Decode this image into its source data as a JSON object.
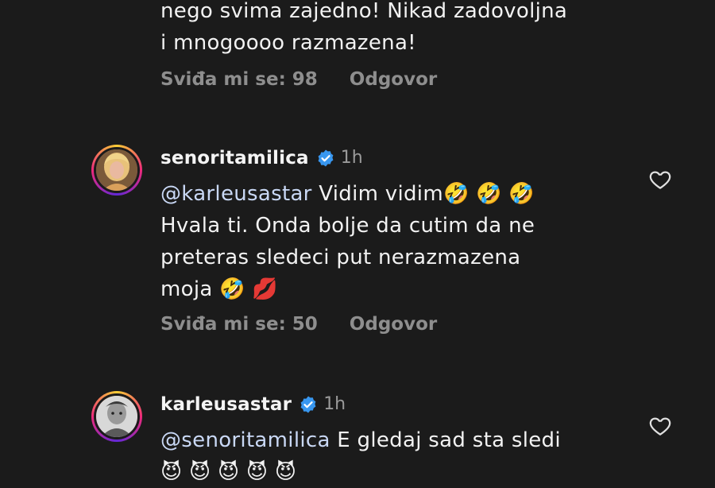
{
  "comments": [
    {
      "text_lines": [
        "nego svima zajedno! Nikad zadovoljna",
        "i mnogoooo razmazena!"
      ],
      "likes_label": "Sviđa mi se: 98",
      "reply_label": "Odgovor"
    },
    {
      "username": "senoritamilica",
      "time": "1h",
      "mention": "@karleusastar",
      "text_lines": [
        " Vidim vidim🤣 🤣 🤣",
        "Hvala ti. Onda bolje da cutim da ne",
        "preteras sledeci put nerazmazena",
        "moja 🤣 💋"
      ],
      "likes_label": "Sviđa mi se: 50",
      "reply_label": "Odgovor"
    },
    {
      "username": "karleusastar",
      "time": "1h",
      "mention": "@senoritamilica",
      "text_lines": [
        " E gledaj sad sta sledi",
        "😈 😈 😈 😈 😈"
      ]
    }
  ],
  "icons": {
    "verified": "verified-badge-icon",
    "heart": "heart-outline-icon",
    "verified_color": "#3897f0"
  }
}
